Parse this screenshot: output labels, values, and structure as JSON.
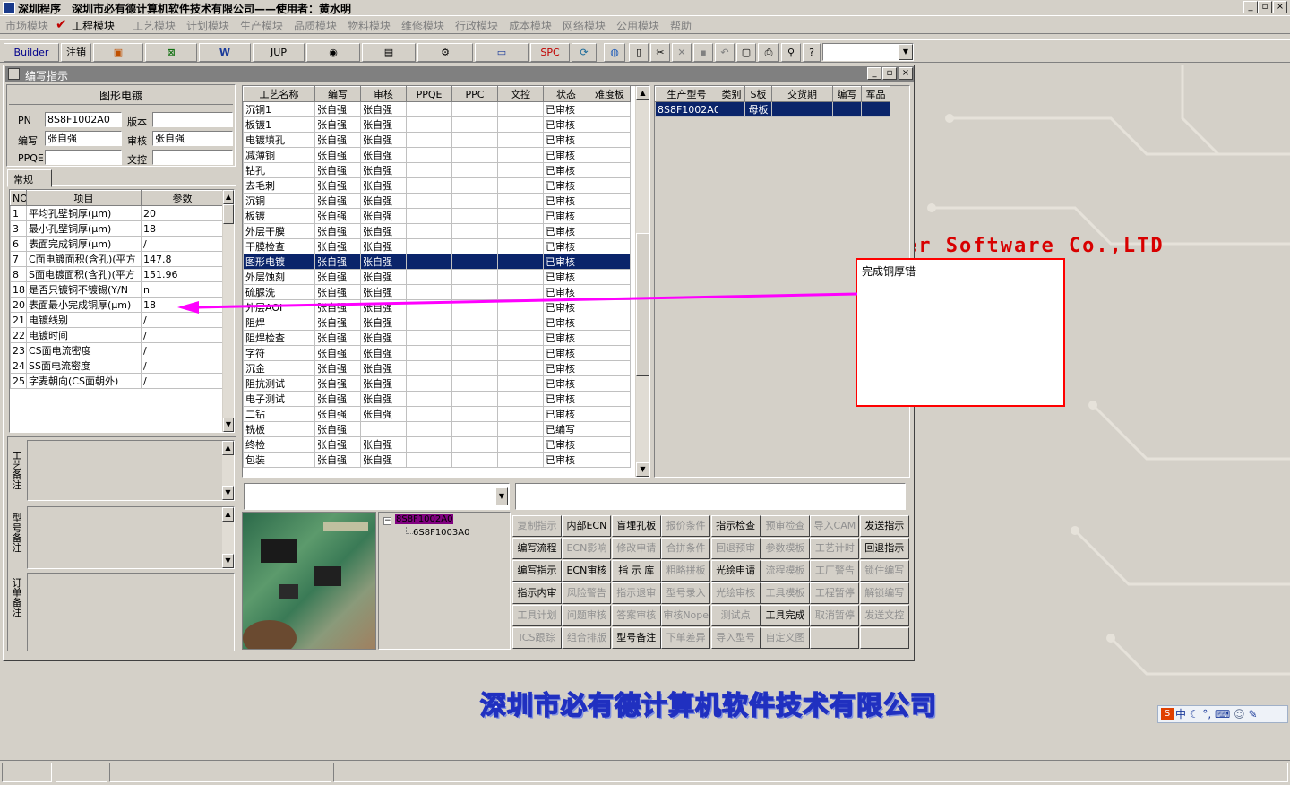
{
  "titlebar": {
    "app_name": "深圳程序",
    "company_user": "深圳市必有德计算机软件技术有限公司——使用者：黄水明"
  },
  "menus": [
    "市场模块",
    "工程模块",
    "工艺模块",
    "计划模块",
    "生产模块",
    "品质模块",
    "物料模块",
    "维修模块",
    "行政模块",
    "成本模块",
    "网络模块",
    "公用模块",
    "帮助"
  ],
  "toolbar": {
    "builder": "Builder",
    "logout": "注销",
    "jup": "JUP",
    "spc": "SPC"
  },
  "window_title": "编写指示",
  "form": {
    "heading": "图形电镀",
    "pn_label": "PN",
    "pn_value": "8S8F1002A0",
    "version_label": "版本",
    "version_value": "",
    "writer_label": "编写",
    "writer_value": "张自强",
    "reviewer_label": "审核",
    "reviewer_value": "张自强",
    "ppqe_label": "PPQE",
    "ppqe_value": "",
    "doc_label": "文控",
    "doc_value": "",
    "tab_general": "常规"
  },
  "params": {
    "headers": [
      "NO",
      "项目",
      "参数"
    ],
    "rows": [
      [
        "1",
        "平均孔壁铜厚(μm)",
        "20"
      ],
      [
        "3",
        "最小孔壁铜厚(μm)",
        "18"
      ],
      [
        "6",
        "表面完成铜厚(μm)",
        "/"
      ],
      [
        "7",
        "C面电镀面积(含孔)(平方",
        "147.8"
      ],
      [
        "8",
        "S面电镀面积(含孔)(平方",
        "151.96"
      ],
      [
        "18",
        "是否只镀铜不镀锡(Y/N",
        "n"
      ],
      [
        "20",
        "表面最小完成铜厚(μm)",
        "18"
      ],
      [
        "21",
        "电镀线别",
        "/"
      ],
      [
        "22",
        "电镀时间",
        "/"
      ],
      [
        "23",
        "CS面电流密度",
        "/"
      ],
      [
        "24",
        "SS面电流密度",
        "/"
      ],
      [
        "25",
        "字麦朝向(CS面朝外)",
        "/"
      ]
    ]
  },
  "side_labels": {
    "process_note": "工艺备注",
    "model_note": "型号备注",
    "order_note": "订单备注"
  },
  "process": {
    "headers": [
      "工艺名称",
      "编写",
      "审核",
      "PPQE",
      "PPC",
      "文控",
      "状态",
      "难度板"
    ],
    "rows": [
      [
        "沉铜1",
        "张自强",
        "张自强",
        "",
        "",
        "",
        "已审核",
        ""
      ],
      [
        "板镀1",
        "张自强",
        "张自强",
        "",
        "",
        "",
        "已审核",
        ""
      ],
      [
        "电镀填孔",
        "张自强",
        "张自强",
        "",
        "",
        "",
        "已审核",
        ""
      ],
      [
        "减薄铜",
        "张自强",
        "张自强",
        "",
        "",
        "",
        "已审核",
        ""
      ],
      [
        "钻孔",
        "张自强",
        "张自强",
        "",
        "",
        "",
        "已审核",
        ""
      ],
      [
        "去毛刺",
        "张自强",
        "张自强",
        "",
        "",
        "",
        "已审核",
        ""
      ],
      [
        "沉铜",
        "张自强",
        "张自强",
        "",
        "",
        "",
        "已审核",
        ""
      ],
      [
        "板镀",
        "张自强",
        "张自强",
        "",
        "",
        "",
        "已审核",
        ""
      ],
      [
        "外层干膜",
        "张自强",
        "张自强",
        "",
        "",
        "",
        "已审核",
        ""
      ],
      [
        "干膜检查",
        "张自强",
        "张自强",
        "",
        "",
        "",
        "已审核",
        ""
      ],
      [
        "图形电镀",
        "张自强",
        "张自强",
        "",
        "",
        "",
        "已审核",
        ""
      ],
      [
        "外层蚀刻",
        "张自强",
        "张自强",
        "",
        "",
        "",
        "已审核",
        ""
      ],
      [
        "硫脲洗",
        "张自强",
        "张自强",
        "",
        "",
        "",
        "已审核",
        ""
      ],
      [
        "外层AOI",
        "张自强",
        "张自强",
        "",
        "",
        "",
        "已审核",
        ""
      ],
      [
        "阻焊",
        "张自强",
        "张自强",
        "",
        "",
        "",
        "已审核",
        ""
      ],
      [
        "阻焊检查",
        "张自强",
        "张自强",
        "",
        "",
        "",
        "已审核",
        ""
      ],
      [
        "字符",
        "张自强",
        "张自强",
        "",
        "",
        "",
        "已审核",
        ""
      ],
      [
        "沉金",
        "张自强",
        "张自强",
        "",
        "",
        "",
        "已审核",
        ""
      ],
      [
        "阻抗测试",
        "张自强",
        "张自强",
        "",
        "",
        "",
        "已审核",
        ""
      ],
      [
        "电子测试",
        "张自强",
        "张自强",
        "",
        "",
        "",
        "已审核",
        ""
      ],
      [
        "二钻",
        "张自强",
        "张自强",
        "",
        "",
        "",
        "已审核",
        ""
      ],
      [
        "铣板",
        "张自强",
        "",
        "",
        "",
        "",
        "已编写",
        ""
      ],
      [
        "终检",
        "张自强",
        "张自强",
        "",
        "",
        "",
        "已审核",
        ""
      ],
      [
        "包装",
        "张自强",
        "张自强",
        "",
        "",
        "",
        "已审核",
        ""
      ]
    ]
  },
  "product": {
    "headers": [
      "生产型号",
      "类别",
      "S板",
      "交货期",
      "编写",
      "军品"
    ],
    "rows": [
      [
        "8S8F1002A0",
        "",
        "母板",
        "",
        "",
        ""
      ]
    ]
  },
  "tree": {
    "root": "8S8F1002A0",
    "child": "6S8F1003A0"
  },
  "actions": [
    [
      "复制指示",
      "内部ECN",
      "盲埋孔板",
      "报价条件",
      "指示检查",
      "预审检查",
      "导入CAM",
      "发送指示"
    ],
    [
      "编写流程",
      "ECN影响",
      "修改申请",
      "合拼条件",
      "回退预审",
      "参数模板",
      "工艺计时",
      "回退指示"
    ],
    [
      "编写指示",
      "ECN审核",
      "指 示 库",
      "粗略拼板",
      "光绘申请",
      "流程模板",
      "工厂警告",
      "锁住编写"
    ],
    [
      "指示内审",
      "风险警告",
      "指示退审",
      "型号录入",
      "光绘审核",
      "工具模板",
      "工程暂停",
      "解锁编写"
    ],
    [
      "工具计划",
      "问题审核",
      "答案审核",
      "审核Nope",
      "测试点",
      "工具完成",
      "取消暂停",
      "发送文控"
    ],
    [
      "ICS跟踪",
      "组合排版",
      "型号备注",
      "下单差异",
      "导入型号",
      "自定义图",
      "",
      ""
    ]
  ],
  "actions_enabled": [
    [
      false,
      true,
      true,
      false,
      true,
      false,
      false,
      true
    ],
    [
      true,
      false,
      false,
      false,
      false,
      false,
      false,
      true
    ],
    [
      true,
      true,
      true,
      false,
      true,
      false,
      false,
      false
    ],
    [
      true,
      false,
      false,
      false,
      false,
      false,
      false,
      false
    ],
    [
      false,
      false,
      false,
      false,
      false,
      true,
      false,
      false
    ],
    [
      false,
      false,
      true,
      false,
      false,
      false,
      false,
      false
    ]
  ],
  "annotation": {
    "text": "完成铜厚错",
    "color": "#ff00ff",
    "box_color": "#ff0000"
  },
  "background": {
    "english": "er Software Co.,LTD",
    "chinese": "深圳市必有德计算机软件技术有限公司"
  },
  "ime": {
    "label": "中"
  }
}
